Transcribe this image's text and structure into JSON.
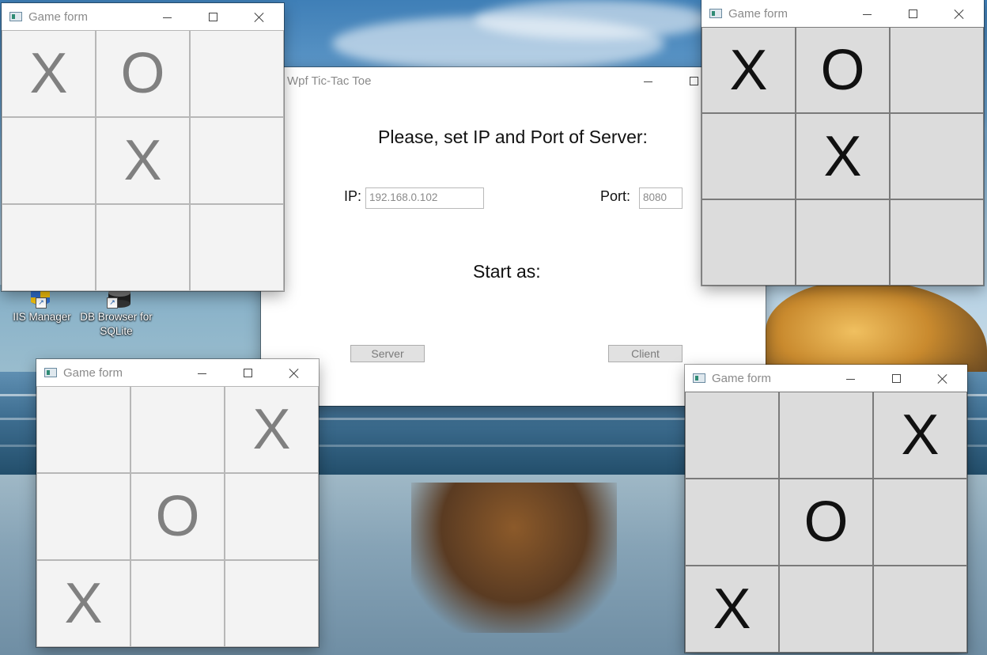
{
  "desktop": {
    "icons": [
      {
        "label": "IIS Manager",
        "icon": "iis-manager-icon"
      },
      {
        "label": "DB Browser for SQLite",
        "icon": "db-browser-icon"
      }
    ]
  },
  "main_window": {
    "title": "Wpf Tic-Tac Toe",
    "heading": "Please, set IP and Port of Server:",
    "ip_label": "IP:",
    "ip_value": "192.168.0.102",
    "port_label": "Port:",
    "port_value": "8080",
    "start_label": "Start as:",
    "server_button": "Server",
    "client_button": "Client"
  },
  "game_windows": [
    {
      "title": "Game form",
      "cells": [
        "X",
        "O",
        "",
        "",
        "X",
        "",
        "",
        "",
        ""
      ]
    },
    {
      "title": "Game form",
      "cells": [
        "X",
        "O",
        "",
        "",
        "X",
        "",
        "",
        "",
        ""
      ]
    },
    {
      "title": "Game form",
      "cells": [
        "",
        "",
        "X",
        "",
        "O",
        "",
        "X",
        "",
        ""
      ]
    },
    {
      "title": "Game form",
      "cells": [
        "",
        "",
        "X",
        "",
        "O",
        "",
        "X",
        "",
        ""
      ]
    }
  ],
  "colors": {
    "light_board_bg": "#f3f3f3",
    "light_mark": "#808080",
    "dark_board_bg": "#dcdcdc",
    "dark_mark": "#111111"
  }
}
